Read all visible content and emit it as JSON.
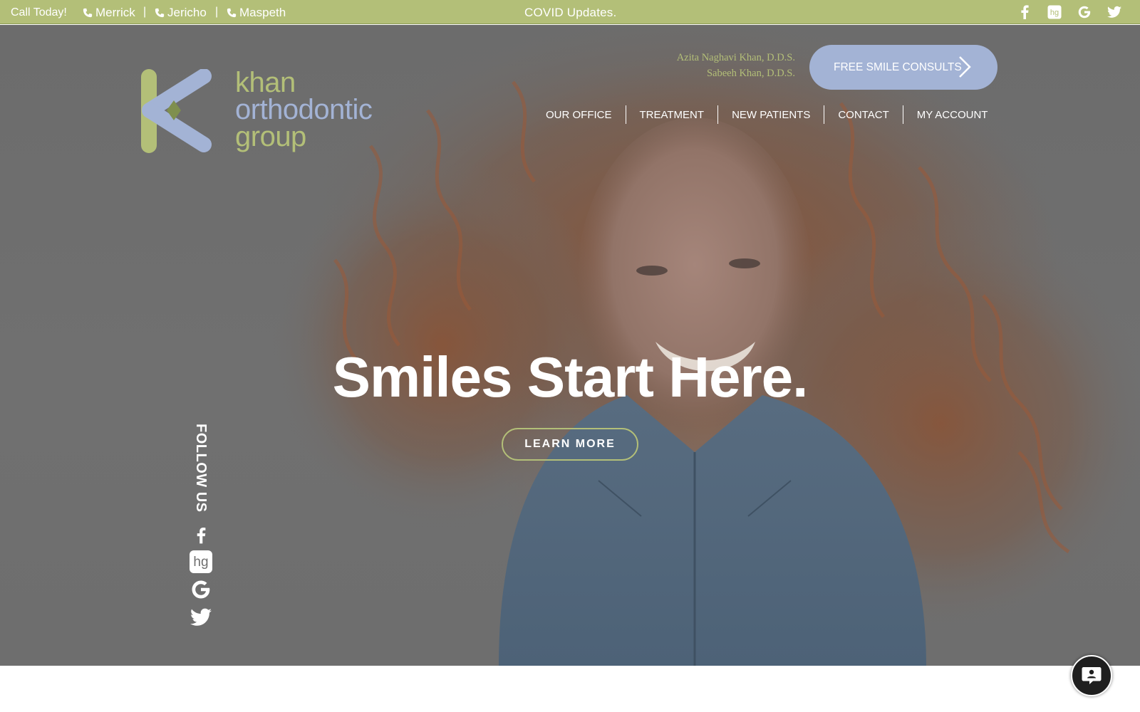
{
  "topbar": {
    "call_label": "Call Today!",
    "locations": [
      "Merrick",
      "Jericho",
      "Maspeth"
    ],
    "separator": "|",
    "covid_label": "COVID Updates.",
    "social_icons": [
      "facebook-icon",
      "houzz-hg-icon",
      "google-icon",
      "twitter-icon"
    ]
  },
  "logo": {
    "line1": "khan",
    "line2": "orthodontic",
    "line3": "group"
  },
  "header": {
    "doctor1": "Azita Naghavi Khan, D.D.S.",
    "doctor2": "Sabeeh Khan, D.D.S.",
    "consult_label": "FREE SMILE CONSULTS"
  },
  "nav": {
    "items": [
      "OUR OFFICE",
      "TREATMENT",
      "NEW PATIENTS",
      "CONTACT",
      "MY ACCOUNT"
    ]
  },
  "hero": {
    "headline": "Smiles Start Here.",
    "cta_label": "LEARN MORE"
  },
  "follow": {
    "label": "FOLLOW US",
    "icons": [
      "facebook-icon",
      "hg-icon",
      "google-icon",
      "twitter-icon"
    ]
  },
  "colors": {
    "accent_green": "#b3bf78",
    "accent_blue": "#a3b3d5"
  }
}
